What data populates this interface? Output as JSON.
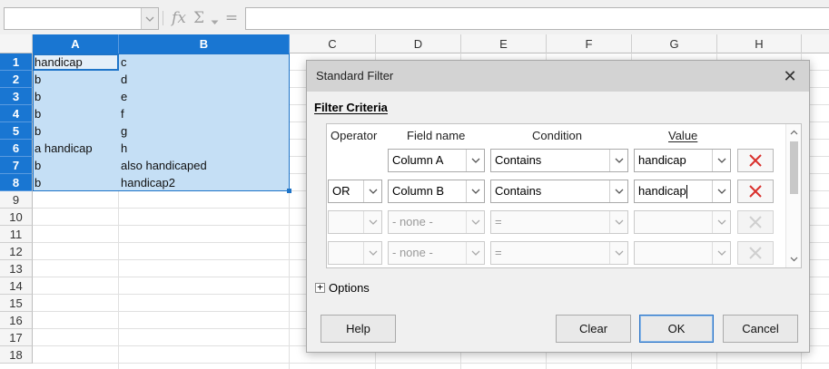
{
  "formula_bar": {
    "name_box_value": "",
    "fx_symbol": "fx",
    "sum_symbol": "Σ",
    "equals_symbol": "=",
    "formula_value": ""
  },
  "spreadsheet": {
    "columns": [
      "A",
      "B",
      "C",
      "D",
      "E",
      "F",
      "G",
      "H"
    ],
    "rows": [
      "1",
      "2",
      "3",
      "4",
      "5",
      "6",
      "7",
      "8",
      "9",
      "10",
      "11",
      "12",
      "13",
      "14",
      "15",
      "16",
      "17",
      "18"
    ],
    "cells": [
      [
        "handicap",
        "c"
      ],
      [
        "b",
        "d"
      ],
      [
        "b",
        "e"
      ],
      [
        "b",
        "f"
      ],
      [
        "b",
        "g"
      ],
      [
        "a handicap",
        "h"
      ],
      [
        "b",
        "also handicaped"
      ],
      [
        "b",
        "handicap2"
      ]
    ]
  },
  "dialog": {
    "title": "Standard Filter",
    "close_symbol": "✕",
    "section_title": "Filter Criteria",
    "headers": {
      "operator": "Operator",
      "field": "Field name",
      "condition": "Condition",
      "value": "Value"
    },
    "criteria_rows": [
      {
        "operator": "",
        "field": "Column A",
        "condition": "Contains",
        "value": "handicap",
        "enabled": true
      },
      {
        "operator": "OR",
        "field": "Column B",
        "condition": "Contains",
        "value": "handicap",
        "enabled": true
      },
      {
        "operator": "",
        "field": "- none -",
        "condition": "=",
        "value": "",
        "enabled": false
      },
      {
        "operator": "",
        "field": "- none -",
        "condition": "=",
        "value": "",
        "enabled": false
      }
    ],
    "options_label": "Options",
    "buttons": {
      "help": "Help",
      "clear": "Clear",
      "ok": "OK",
      "cancel": "Cancel"
    }
  },
  "colors": {
    "selection_accent": "#1976d2",
    "selection_fill": "#c5dff5",
    "remove_icon_active": "#d9302c",
    "remove_icon_disabled": "#cfcfcf"
  },
  "icons": {
    "namebox_dropdown": "chevron-down-icon",
    "function_wizard": "fx-icon",
    "sum": "sum-icon",
    "remove_condition": "red-x-icon",
    "options_expand": "plus-box-icon"
  }
}
